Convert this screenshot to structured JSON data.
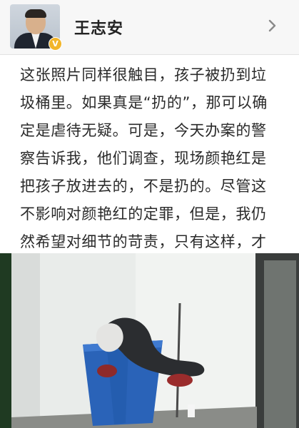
{
  "header": {
    "author_name": "王志安",
    "verified_icon": "verified-v-badge-icon",
    "avatar_icon": "profile-photo",
    "chevron_icon": "chevron-right-icon"
  },
  "post": {
    "text": "这张照片同样很触目，孩子被扔到垃\n圾桶里。如果真是“扔的”，那可以确\n定是虐待无疑。可是，今天办案的警\n察告诉我，他们调查，现场颜艳红是\n把孩子放进去的，不是扔的。尽管这\n不影响对颜艳红的定罪，但是，我仍\n然希望对细节的苛责，只有这样，才\n能抵达真相。",
    "image_icon": "attached-photo-child-in-trash-bin"
  },
  "colors": {
    "header_bg": "#f7f7f7",
    "text": "#2a2a2a",
    "badge": "#f2b52a",
    "bin_blue": "#2a63b8"
  }
}
